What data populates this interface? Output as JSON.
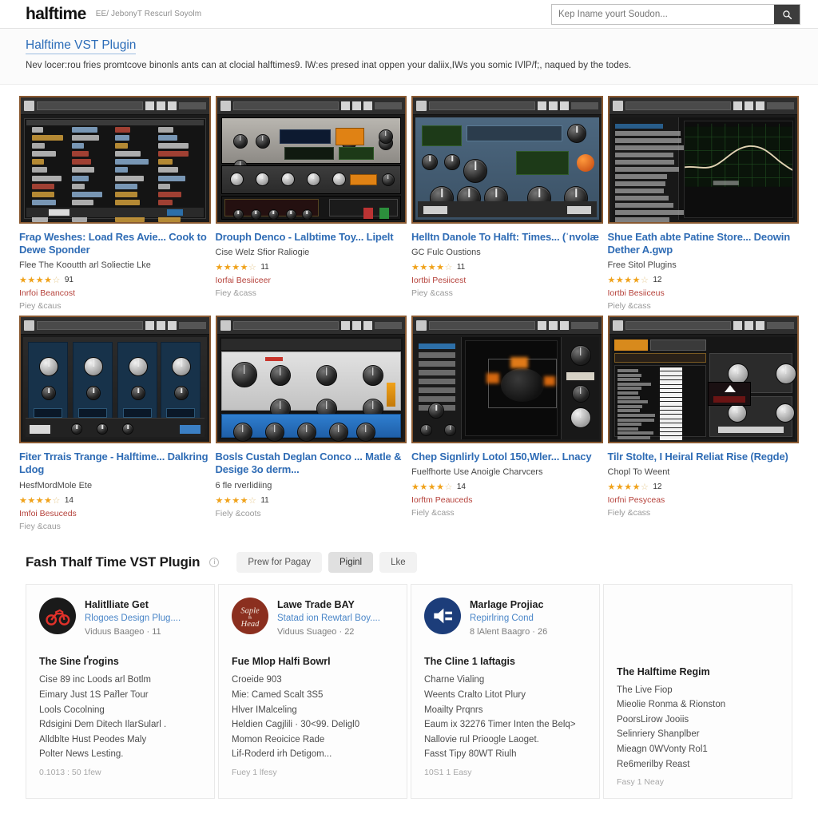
{
  "header": {
    "brand": "halftime",
    "brand_tagline": "EE/ JebonyT Rescurl Soyolm",
    "search_placeholder": "Kep Iname yourt Soudon...",
    "search_value": "",
    "search_icon": "search-icon"
  },
  "band": {
    "title": "Halftime VST Plugin",
    "description": "Nev locer:rou fries promtcove binonls ants can at clocial halftimes9. lW:es presed inat oppen your daliix,IWs you somic IVlP/f;, naqued by the todes."
  },
  "results": [
    {
      "title": "Fraρ Weshes: Load Res Avie... Cook to Dewe Sponder",
      "subtitle": "Flee The Kooutth arl Soliectie Lke",
      "stars": 4,
      "rating_count": "91",
      "price": "Inrfoi Beancost",
      "meta": "Piey  &caus",
      "art": "daw-browser"
    },
    {
      "title": "Drouph Denco - Lalbtime Toy... Lipelt",
      "subtitle": "Cise Welz Sfior Raliogie",
      "stars": 4,
      "rating_count": "11",
      "price": "Iorfai Besiiceer",
      "meta": "Fiey  &cass",
      "art": "tape-rack"
    },
    {
      "title": "Helltn Danole To Halft: Times... (ˈnvolæ",
      "subtitle": "GC Fulc Oustions",
      "stars": 4,
      "rating_count": "11",
      "price": "Iortbi Pesiicest",
      "meta": "Piey  &cass",
      "art": "blue-knobs"
    },
    {
      "title": "Shue Eath abte Patine Store... Deowin Dether A.gwp",
      "subtitle": "Free Sitol Plugins",
      "stars": 4,
      "rating_count": "12",
      "price": "Iortbi Besiiceus",
      "meta": "Piely  &cass",
      "art": "eq-curve"
    },
    {
      "title": "Fiter Trrais Trange - Halftime... Dalkring Ldog",
      "subtitle": "HesfMordMole Ete",
      "stars": 4,
      "rating_count": "14",
      "price": "Imfoi Besuceds",
      "meta": "Fiey  &caus",
      "art": "navy-modules"
    },
    {
      "title": "Bosls Custah Deglan Conco ... Matle & Desige 3o derm...",
      "subtitle": "6 fle rverlidiing",
      "stars": 4,
      "rating_count": "11",
      "price": "",
      "meta": "Fiely  &coots",
      "art": "silver-blue"
    },
    {
      "title": "Chep Signlirly Lotol 150,Wler... Lnacy",
      "subtitle": "Fuelfhorte Use Anoigle Charvcers",
      "stars": 4,
      "rating_count": "14",
      "price": "Iorftm Peauceds",
      "meta": "Fiely  &cass",
      "art": "big-dial"
    },
    {
      "title": "Tilr Stolte, I Heiral Reliat Rise (Regde)",
      "subtitle": "Chopl To Weent",
      "stars": 4,
      "rating_count": "12",
      "price": "Iorfni Pesyceas",
      "meta": "Fiely  &cass",
      "art": "keys-orange"
    }
  ],
  "section2": {
    "title": "Fash Thalf Time VST Plugin",
    "info_icon": "info-icon",
    "tabs": [
      {
        "label": "Prew for Pagay",
        "active": false
      },
      {
        "label": "Piginl",
        "active": true
      },
      {
        "label": "Lke",
        "active": false
      }
    ],
    "panels": [
      {
        "has_header": true,
        "avatar_icon": "motorcycle-logo-icon",
        "avatar_bg": "#1a1a1a",
        "avatar_fg": "#e0312a",
        "name": "Halitlliate Get",
        "link": "Rlogoes Design Plug....",
        "meta": "Viduus Baageo · 11",
        "body_title": "The Sine Ґrogins",
        "lines": [
          "Cise 89 inc Loods arl Botlm",
          "Eimary Just 1S Pařler Tour",
          "Lools Cocolning",
          "Rdsigini Dem Ditech IlarSularl .",
          "Alldblte Hust Peodes Maly",
          "Polter News Lesting."
        ],
        "foot": "0.1013 : 50 1few"
      },
      {
        "has_header": true,
        "avatar_icon": "staple-head-logo-icon",
        "avatar_bg": "#8b2f1f",
        "avatar_fg": "#f2e6dc",
        "name": "Lawe Trade BAY",
        "link": "Statad ion Rewtarl Boy....",
        "meta": "Viduus Suageo · 22",
        "body_title": "Fue Mlop Halfi Bowrl",
        "lines": [
          "Croeide 903",
          "Mie: Camed Scalt 3S5",
          "Hlver IMalceling",
          "Heldien Cagjlili · 30<99. Deligl0",
          "Momon Reoicice Rade",
          "Lif-Roderd irh Detigom..."
        ],
        "foot": "Fuey 1 lfesy"
      },
      {
        "has_header": true,
        "avatar_icon": "speaker-volume-icon",
        "avatar_bg": "#1c3d7a",
        "avatar_fg": "#ffffff",
        "name": "Marlage Projiac",
        "link": "Repirlring Cond",
        "meta": "8 lAlent Baagro · 26",
        "body_title": "The Cline 1 Iaftagis",
        "lines": [
          "Charne Vialing",
          "Weents Cralto Litot Plury",
          "Moailty Prqnrs",
          "Eaum ix 32276 Timer Inten the Belq>",
          "Nallovie rul Prioogle Laoget.",
          "Fasst Tipy 80WT Riulh"
        ],
        "foot": "10S1 1 Easy"
      },
      {
        "has_header": false,
        "avatar_icon": "",
        "avatar_bg": "",
        "avatar_fg": "",
        "name": "",
        "link": "",
        "meta": "",
        "body_title": "The Halftime Regim",
        "lines": [
          "The Live Fiop",
          "Mieolie Ronma & Rionston",
          "PoorsLirow Jooiis",
          "Selinriery Shanplber",
          "Mieagn 0WVonty Rol1",
          "Re6merilby Reast"
        ],
        "foot": "Fasy 1 Neay"
      }
    ]
  },
  "colors": {
    "link_blue": "#2f6cb5",
    "star_gold": "#f0a21a",
    "price_red": "#b5413a",
    "thumb_border": "#8a5a32"
  }
}
